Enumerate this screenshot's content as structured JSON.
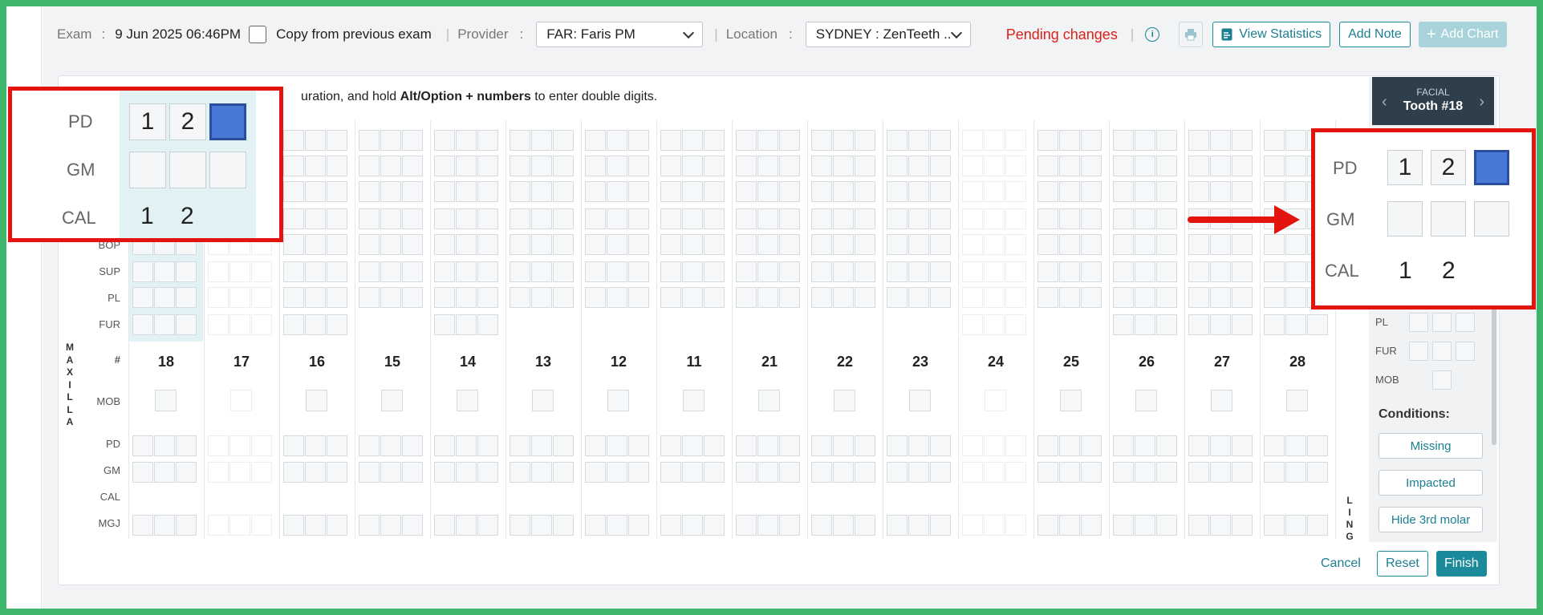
{
  "toolbar": {
    "exam_label": "Exam",
    "colon": ":",
    "exam_date": "9 Jun 2025 06:46PM",
    "copy_label": "Copy from previous exam",
    "provider_label": "Provider",
    "provider_value": "FAR: Faris PM",
    "location_label": "Location",
    "location_value": "SYDNEY : ZenTeeth ..",
    "pending": "Pending changes",
    "view_statistics": "View Statistics",
    "add_note": "Add Note",
    "add_chart": "Add Chart"
  },
  "hint": {
    "pre": "uration, and hold ",
    "bold": "Alt/Option + numbers",
    "post": " to enter double digits."
  },
  "chart": {
    "teeth": [
      "18",
      "17",
      "16",
      "15",
      "14",
      "13",
      "12",
      "11",
      "21",
      "22",
      "23",
      "24",
      "25",
      "26",
      "27",
      "28"
    ],
    "hash": "#",
    "upper_rows": [
      "BOP",
      "SUP",
      "PL",
      "FUR"
    ],
    "mob_label": "MOB",
    "lower_rows": [
      "PD",
      "GM",
      "CAL",
      "MGJ"
    ],
    "maxilla": [
      "M",
      "A",
      "X",
      "I",
      "L",
      "L",
      "A"
    ],
    "lingual": [
      "L",
      "I",
      "N",
      "G"
    ]
  },
  "side": {
    "facial": "FACIAL",
    "tooth": "Tooth #18",
    "rows": [
      "PL",
      "FUR",
      "MOB"
    ],
    "conditions_label": "Conditions:",
    "conditions": [
      "Missing",
      "Impacted",
      "Hide 3rd molar"
    ]
  },
  "zoom_left": {
    "labels": [
      "PD",
      "GM",
      "CAL"
    ],
    "pd": [
      "1",
      "2"
    ],
    "cal": [
      "1",
      "2"
    ]
  },
  "zoom_right": {
    "labels": [
      "PD",
      "GM",
      "CAL"
    ],
    "pd": [
      "1",
      "2"
    ],
    "cal": [
      "1",
      "2"
    ]
  },
  "footer": {
    "cancel": "Cancel",
    "reset": "Reset",
    "finish": "Finish"
  },
  "colors": {
    "accent": "#1b8a9b",
    "pending": "#e0201b",
    "annotation": "#e3140e",
    "frame": "#3db56b"
  }
}
